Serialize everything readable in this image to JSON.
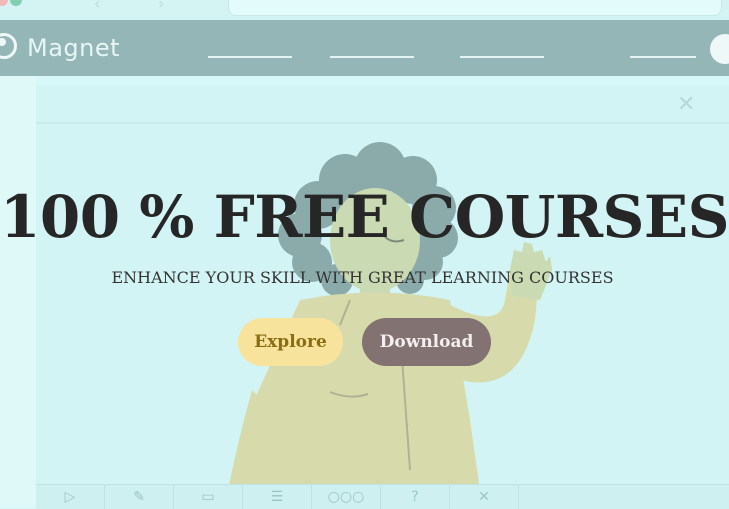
{
  "app": {
    "brand": "Magnet"
  },
  "hero": {
    "title": "100 % FREE COURSES",
    "subtitle": "ENHANCE YOUR SKILL WITH GREAT LEARNING COURSES"
  },
  "actions": {
    "explore_label": "Explore",
    "download_label": "Download"
  },
  "icons": {
    "toolbar": [
      "play-icon",
      "pencil-icon",
      "eraser-icon",
      "comment-icon",
      "more-icon",
      "help-icon",
      "close-icon"
    ],
    "glyphs": [
      "▷",
      "✎",
      "▭",
      "☰",
      "○○○",
      "?",
      "✕"
    ]
  },
  "colors": {
    "background": "#d8f7f7",
    "appbar": "#94b6b6",
    "explore_button": "#f8e39c",
    "download_button": "#827272",
    "title_text": "#262626"
  }
}
